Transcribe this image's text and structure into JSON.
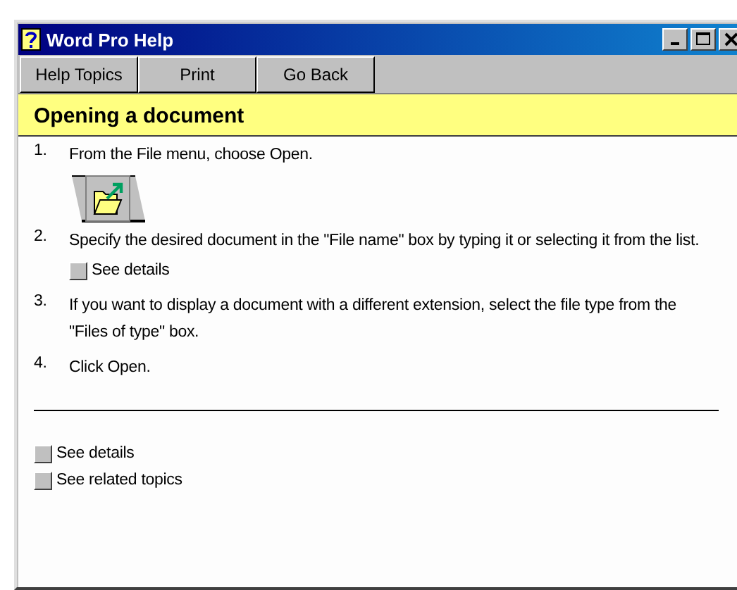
{
  "window": {
    "title": "Word Pro Help"
  },
  "toolbar": [
    {
      "label": "Help Topics"
    },
    {
      "label": "Print"
    },
    {
      "label": "Go Back"
    }
  ],
  "heading": "Opening a document",
  "steps": [
    {
      "number": "1.",
      "text": "From the File menu, choose Open.",
      "extras": [
        {
          "kind": "icon"
        }
      ]
    },
    {
      "number": "2.",
      "text": "Specify the desired document in the \"File name\" box by typing it or selecting it from the list.",
      "extras": [
        {
          "kind": "link",
          "label": "See details"
        }
      ]
    },
    {
      "number": "3.",
      "text": "If you want to display a document with a different extension, select the file type from the \"Files of type\" box."
    },
    {
      "number": "4.",
      "text": "Click Open."
    }
  ],
  "footer_links": [
    {
      "label": "See details"
    },
    {
      "label": "See related topics"
    }
  ]
}
